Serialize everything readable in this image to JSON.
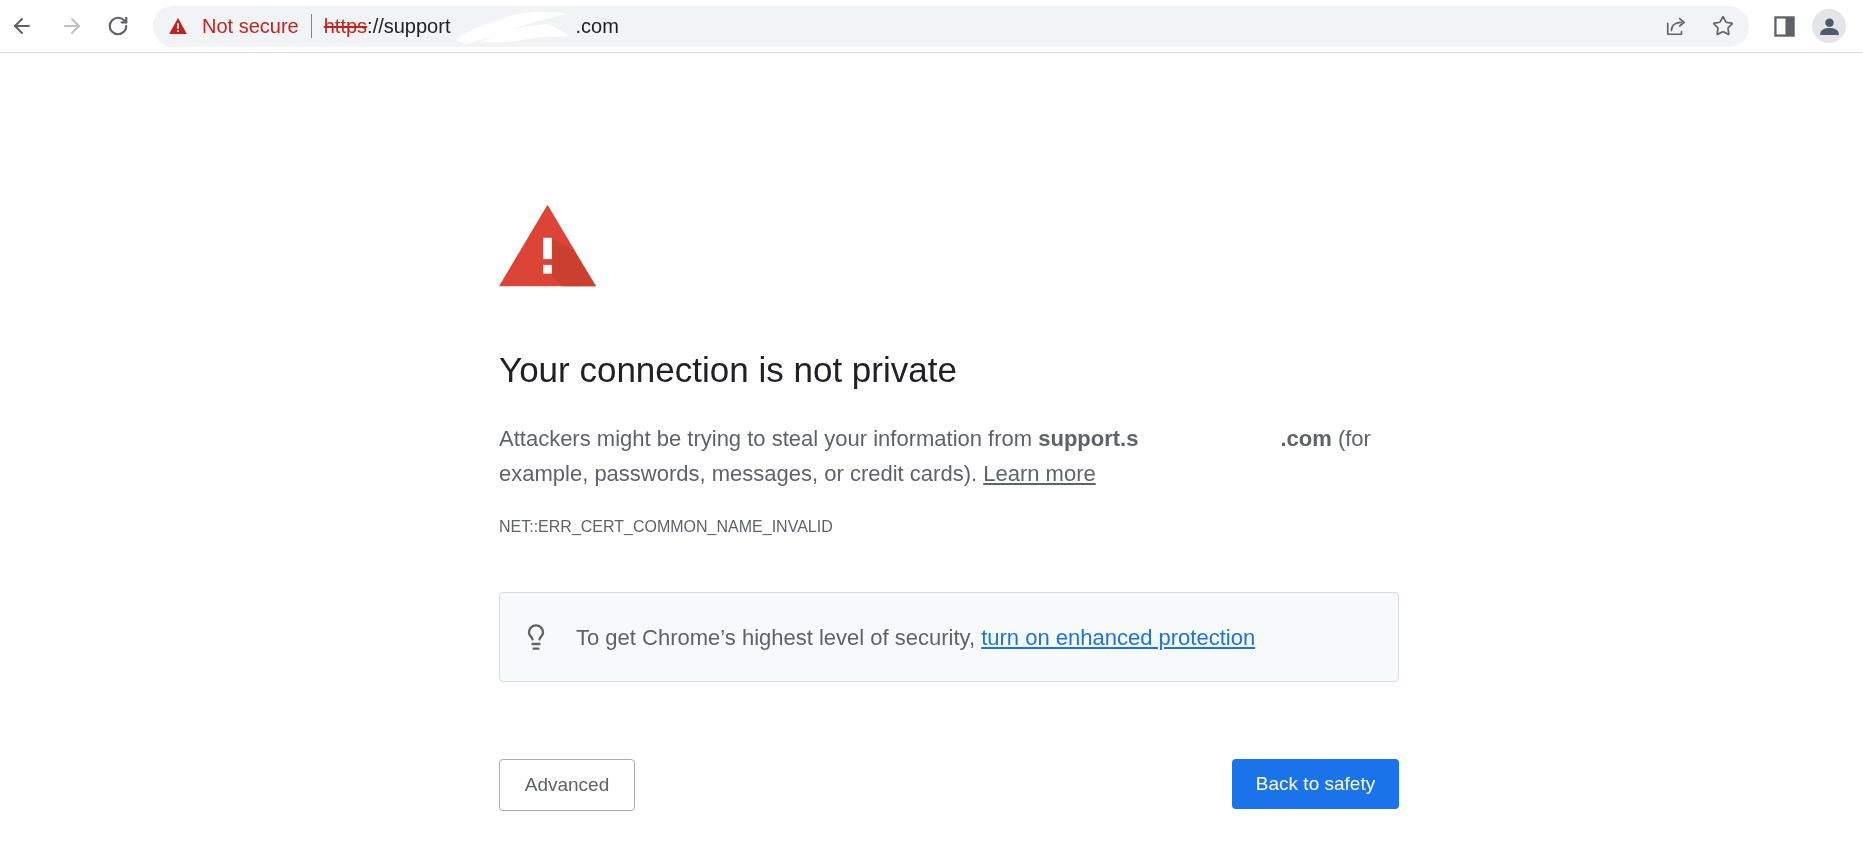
{
  "toolbar": {
    "back": {
      "disabled": false
    },
    "forward": {
      "disabled": true
    },
    "address_bar": {
      "security_label": "Not secure",
      "scheme": "https",
      "url_start": "://support",
      "url_end": ".com"
    }
  },
  "interstitial": {
    "heading": "Your connection is not private",
    "paragraph": {
      "lead": "Attackers might be trying to steal your information from ",
      "host_start": "support.s",
      "host_end": ".com",
      "trail": " (for example, passwords, messages, or credit cards). ",
      "link": "Learn more"
    },
    "error_code": "NET::ERR_CERT_COMMON_NAME_INVALID",
    "tip": {
      "text": "To get Chrome’s highest level of security, ",
      "link": "turn on enhanced protection"
    },
    "buttons": [
      {
        "label": "Advanced",
        "kind": "secondary"
      },
      {
        "label": "Back to safety",
        "kind": "primary"
      }
    ]
  }
}
